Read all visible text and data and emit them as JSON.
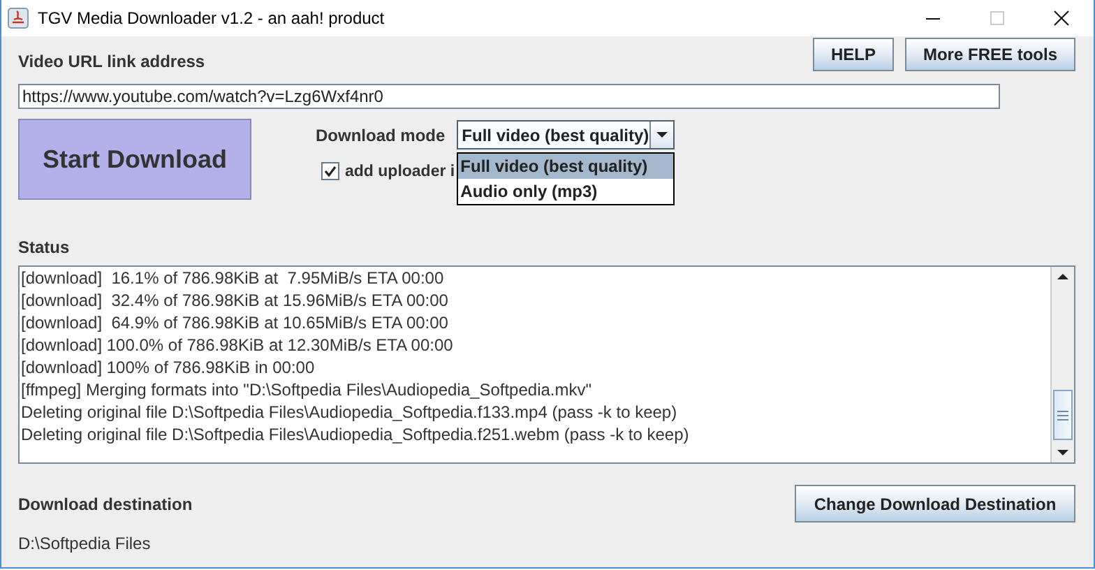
{
  "window": {
    "title": "TGV Media Downloader v1.2 - an aah! product"
  },
  "top_buttons": [
    "HELP",
    "More FREE tools"
  ],
  "url": {
    "label": "Video URL link address",
    "value": "https://www.youtube.com/watch?v=Lzg6Wxf4nr0"
  },
  "start_button": "Start Download",
  "download_mode": {
    "label": "Download mode",
    "value": "Full video (best quality)",
    "expanded": true,
    "options": [
      {
        "label": "Full video (best quality)",
        "selected": true
      },
      {
        "label": "Audio only (mp3)",
        "selected": false
      }
    ]
  },
  "checkbox": {
    "label": "add uploader i",
    "checked": true
  },
  "status": {
    "label": "Status",
    "lines": [
      "[download]  16.1% of 786.98KiB at  7.95MiB/s ETA 00:00",
      "[download]  32.4% of 786.98KiB at 15.96MiB/s ETA 00:00",
      "[download]  64.9% of 786.98KiB at 10.65MiB/s ETA 00:00",
      "[download] 100.0% of 786.98KiB at 12.30MiB/s ETA 00:00",
      "[download] 100% of 786.98KiB in 00:00",
      "[ffmpeg] Merging formats into \"D:\\Softpedia Files\\Audiopedia_Softpedia.mkv\"",
      "Deleting original file D:\\Softpedia Files\\Audiopedia_Softpedia.f133.mp4 (pass -k to keep)",
      "Deleting original file D:\\Softpedia Files\\Audiopedia_Softpedia.f251.webm (pass -k to keep)"
    ]
  },
  "destination": {
    "label": "Download destination",
    "button": "Change Download Destination",
    "path": "D:\\Softpedia Files"
  }
}
